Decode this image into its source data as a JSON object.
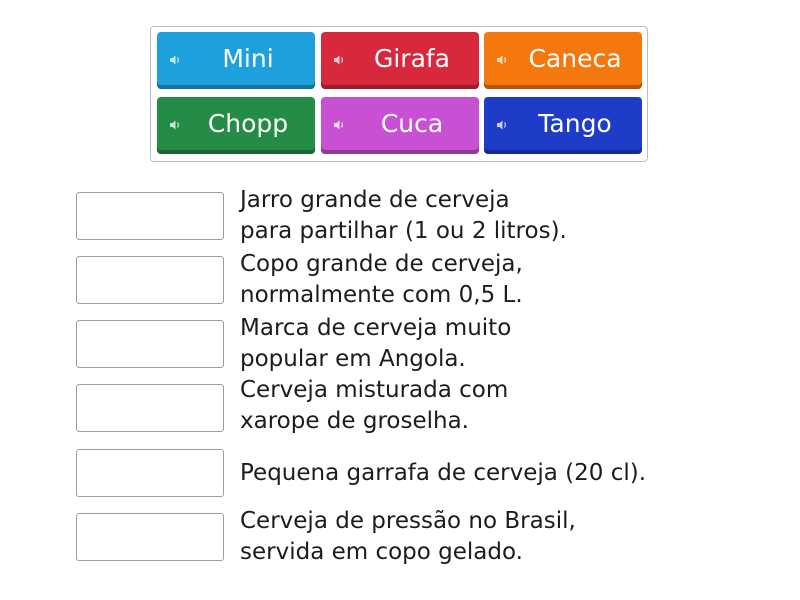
{
  "tiles": [
    {
      "label": "Mini",
      "color": "#1ea0dc"
    },
    {
      "label": "Girafa",
      "color": "#d7283c"
    },
    {
      "label": "Caneca",
      "color": "#f5780f"
    },
    {
      "label": "Chopp",
      "color": "#248c46"
    },
    {
      "label": "Cuca",
      "color": "#c850d2"
    },
    {
      "label": "Tango",
      "color": "#1e3cc8"
    }
  ],
  "speaker_icon": "speaker-icon",
  "descriptions": [
    "Jarro grande de cerveja\npara partilhar (1 ou 2 litros).",
    "Copo grande de cerveja,\nnormalmente com 0,5 L.",
    "Marca de cerveja muito\npopular em Angola.",
    "Cerveja misturada com\nxarope de groselha.",
    "Pequena garrafa de cerveja (20 cl).",
    "Cerveja de pressão no Brasil,\nservida em copo gelado."
  ]
}
